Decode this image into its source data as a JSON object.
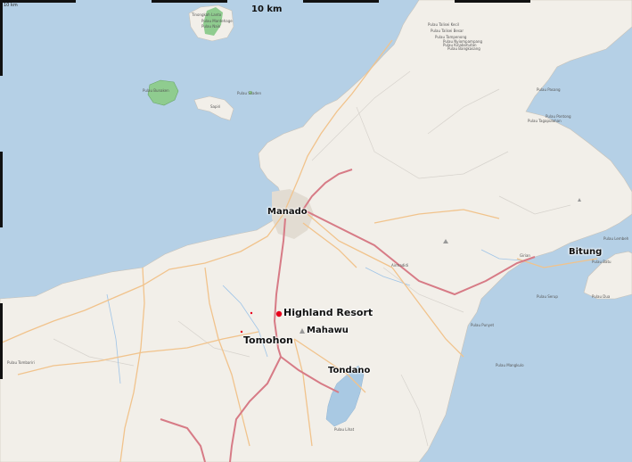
{
  "scale": {
    "label": "10 km",
    "corner_label": "10 km"
  },
  "places": {
    "manado": "Manado",
    "bitung": "Bitung",
    "highland_resort": "Highland Resort",
    "tomohon": "Tomohon",
    "mahawu": "Mahawu",
    "tondano": "Tondano",
    "airmadidi": "Airmadidi",
    "girian": "Girian"
  },
  "islands": {
    "tinongkah": "Tinongkah Lanto",
    "pulau_manterawu": "Pulau Mantehage",
    "pulau_nain": "Pulau Nain",
    "pulau_bunaken": "Pulau Bunaken",
    "pulau_siladen": "Pulau Siladen",
    "pulau_telaga_kecil": "Pulau Talisei Kecil",
    "pulau_telaga_besar": "Pulau Talisei Besar",
    "pulau_tamperong": "Pulau Tampenong",
    "pulau_nyiompampang": "Pulau Nyiompampang",
    "pulau_kinabohutan": "Pulau Kinabohutan",
    "pulau_bangkasang": "Pulau Bangkasang",
    "pulau_pasang": "Pulau Pasang",
    "pulau_pontong": "Pulau Pontong",
    "pulau_tagapulahan": "Pulau Tagapulahan",
    "pulau_lembeh": "Pulau Lembeh",
    "pulau_batu_kapal": "Pulau Batu",
    "pulau_dua": "Pulau Dua",
    "pulau_sarup": "Pulau Serup",
    "pulau_punyet": "Pulau Punyet",
    "pulau_likupang": "Pulau Likupang",
    "pulau_hungurpanan": "Pulau Mangkulo",
    "pulau_tombariri": "Pulau Tombariri",
    "pulau_lihat": "Pulau Lihat",
    "sapiri": "Sapiri"
  },
  "colors": {
    "sea": "#b5d0e6",
    "land": "#f2efe9",
    "park": "#8fcc8f",
    "lake": "#a9c9e3",
    "main_road": "#d77b86",
    "secondary_road": "#f1c38c",
    "minor_road": "#cfcfcf",
    "river": "#9ec4e8",
    "poi_marker": "#e8001c"
  }
}
